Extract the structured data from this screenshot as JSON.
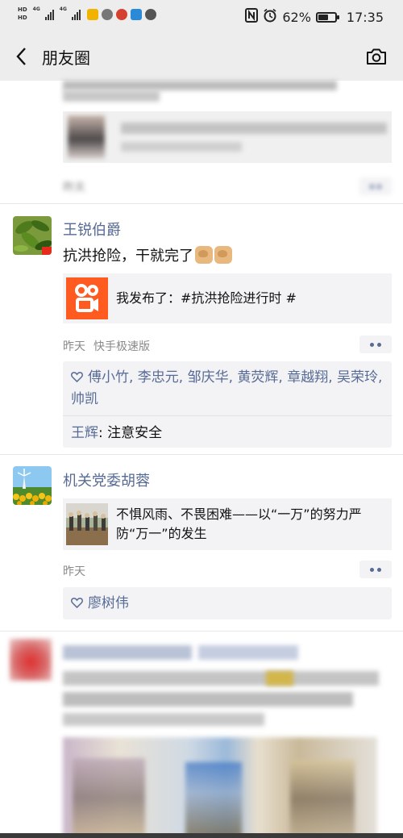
{
  "status_bar": {
    "hd_1": "HD",
    "hd_2": "HD",
    "net_1": "4G",
    "net_2": "4G",
    "battery_text": "62%",
    "battery_level": 0.62,
    "time": "17:35"
  },
  "nav": {
    "title": "朋友圈",
    "back_icon": "back-chevron-icon",
    "camera_icon": "camera-icon"
  },
  "posts": [
    {
      "blurred": true,
      "time": "昨天"
    },
    {
      "name": "王锐伯爵",
      "text": "抗洪抢险，干就完了",
      "emoji": "flexed-biceps",
      "card_icon": "kuaishou-icon",
      "card_text": "我发布了：#抗洪抢险进行时 #",
      "time": "昨天",
      "app": "快手极速版",
      "likes": "傅小竹, 李忠元, 邹庆华, 黄荧辉, 章越翔, 吴荣玲, 帅凯",
      "comment_user": "王辉",
      "comment_text": ": 注意安全"
    },
    {
      "name": "机关党委胡蓉",
      "card_text_1": "不惧风雨、不畏困难——以“一万”的努力严",
      "card_text_2": "防“万一”的发生",
      "time": "昨天",
      "likes": "廖树伟"
    },
    {
      "blurred": true
    }
  ],
  "colors": {
    "link_blue": "#576b95",
    "kuaishou_orange": "#ff5a1f",
    "background_gray": "#ededed"
  }
}
